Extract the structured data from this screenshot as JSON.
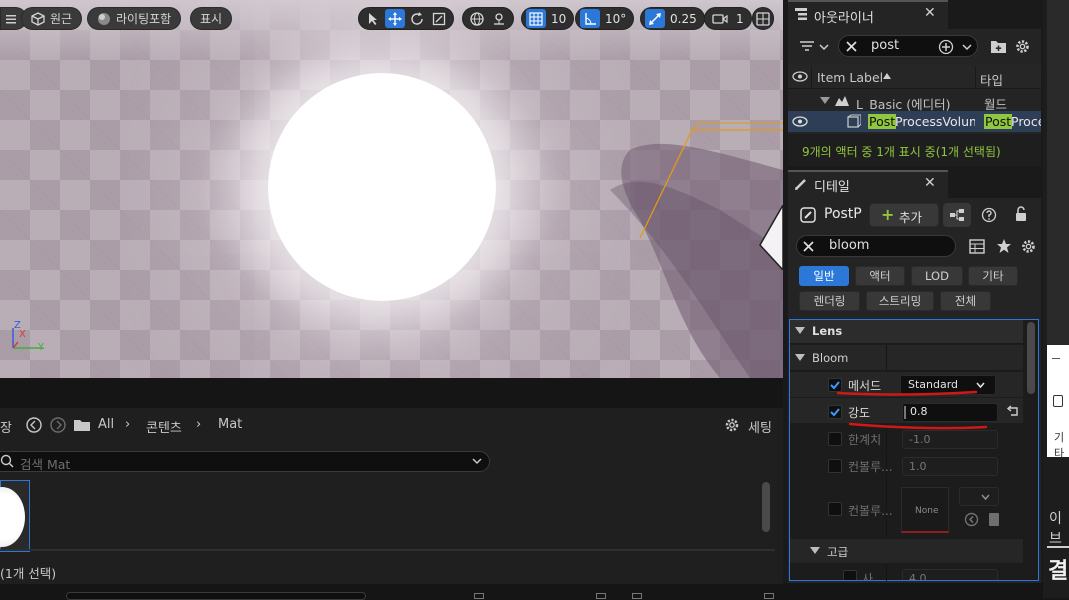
{
  "viewport": {
    "perspective_label": "원근",
    "lit_label": "라이팅포함",
    "show_label": "표시",
    "grid_snap_value": "10",
    "rotate_snap_value": "10°",
    "scale_snap_value": "0.25",
    "camera_speed_value": "1",
    "axis_z": "Z",
    "axis_x": "X",
    "axis_y": "Y"
  },
  "outliner": {
    "tab_title": "아웃라이너",
    "search_value": "post",
    "col_item_label": "Item Label",
    "col_type": "타입",
    "level_row_label": "L_Basic (에디터)",
    "level_row_type": "월드",
    "actor_row_label_highlight": "Post",
    "actor_row_label_rest": "ProcessVolum",
    "actor_row_type_highlight": "Post",
    "actor_row_type_rest": "Proce",
    "status_text": "9개의 액터 중 1개 표시 중(1개 선택됨)",
    "status_color": "#8fc73e"
  },
  "details": {
    "tab_title": "디테일",
    "object_name": "PostP",
    "add_label": "추가",
    "search_value": "bloom",
    "categories": [
      "일반",
      "액터",
      "LOD",
      "기타",
      "렌더링",
      "스트리밍",
      "전체"
    ],
    "active_category": "일반",
    "section_lens": "Lens",
    "section_bloom": "Bloom",
    "section_advanced": "고급",
    "method_label": "메서드",
    "method_value": "Standard",
    "intensity_label": "강도",
    "intensity_value": "0.8",
    "threshold_label": "한계치",
    "threshold_value": "-1.0",
    "convolution_scale_label": "컨볼루...",
    "convolution_scale_value": "1.0",
    "convolution_kernel_label": "컨볼루...",
    "convolution_kernel_value": "None",
    "advanced_row_label": "사",
    "advanced_row_value": "4.0",
    "underline_color": "#d01818"
  },
  "content_browser": {
    "left_partial_label": "장",
    "breadcrumb_all": "All",
    "breadcrumb_content": "콘텐츠",
    "breadcrumb_mat": "Mat",
    "settings_label": "세팅",
    "search_placeholder": "검색 Mat",
    "selection_status": "(1개 선택)"
  },
  "right_window": {
    "partial_text_1": "기타",
    "partial_text_2": "이브",
    "partial_text_3": "결"
  }
}
